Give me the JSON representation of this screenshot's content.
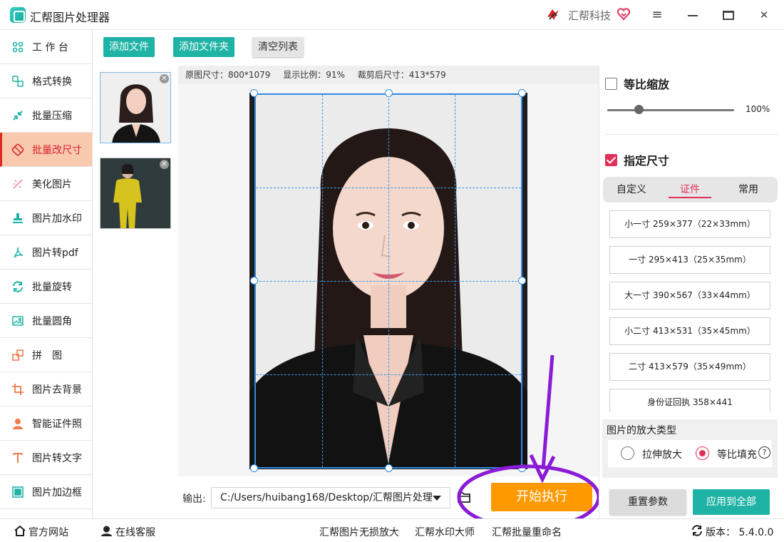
{
  "app": {
    "title": "汇帮图片处理器",
    "brand": "汇帮科技"
  },
  "window": {
    "menu_icon": "≡",
    "maximize_icon": "□",
    "close_icon": "✕"
  },
  "colors": {
    "accent": "#1fb3a6",
    "active_red": "#e0305a",
    "start_orange": "#ff9900",
    "annotation_purple": "#8a1bd6"
  },
  "sidebar": {
    "items": [
      {
        "label": "工 作 台",
        "icon": "grid-icon"
      },
      {
        "label": "格式转换",
        "icon": "convert-icon"
      },
      {
        "label": "批量压缩",
        "icon": "compress-icon"
      },
      {
        "label": "批量改尺寸",
        "icon": "resize-icon",
        "active": true
      },
      {
        "label": "美化图片",
        "icon": "beautify-icon"
      },
      {
        "label": "图片加水印",
        "icon": "stamp-icon"
      },
      {
        "label": "图片转pdf",
        "icon": "pdf-icon"
      },
      {
        "label": "批量旋转",
        "icon": "rotate-icon"
      },
      {
        "label": "批量圆角",
        "icon": "image-icon"
      },
      {
        "label": "拼　图",
        "icon": "puzzle-icon"
      },
      {
        "label": "图片去背景",
        "icon": "crop-icon"
      },
      {
        "label": "智能证件照",
        "icon": "person-icon"
      },
      {
        "label": "图片转文字",
        "icon": "text-icon"
      },
      {
        "label": "图片加边框",
        "icon": "frame-icon"
      }
    ]
  },
  "toolbar": {
    "add_file": "添加文件",
    "add_folder": "添加文件夹",
    "clear_list": "清空列表"
  },
  "info": {
    "original_size": "原图尺寸：800*1079",
    "display_ratio": "显示比例：91%",
    "cropped_size": "裁剪后尺寸：413*579"
  },
  "output": {
    "label": "输出:",
    "path": "C:/Users/huibang168/Desktop/汇帮图片处理",
    "start_button": "开始执行"
  },
  "right": {
    "proportional_label": "等比缩放",
    "proportional_checked": false,
    "scale_value": "100%",
    "scale_fraction": 0.25,
    "specify_size_label": "指定尺寸",
    "specify_checked": true,
    "tabs": [
      {
        "label": "自定义"
      },
      {
        "label": "证件",
        "active": true
      },
      {
        "label": "常用"
      }
    ],
    "sizes": [
      "小一寸 259×377（22×33mm）",
      "一寸 295×413（25×35mm）",
      "大一寸 390×567（33×44mm）",
      "小二寸 413×531（35×45mm）",
      "二寸 413×579（35×49mm）",
      "身份证回执 358×441"
    ],
    "zoom_type_title": "图片的放大类型",
    "stretch_label": "拉伸放大",
    "fill_label": "等比填充",
    "selected_zoom": "fill",
    "help_glyph": "?",
    "reset_button": "重置参数",
    "apply_all_button": "应用到全部"
  },
  "status": {
    "official_site": "官方网站",
    "online_service": "在线客服",
    "lossless": "汇帮图片无损放大",
    "watermark": "汇帮水印大师",
    "rename": "汇帮批量重命名",
    "version": "版本：  5.4.0.0"
  }
}
